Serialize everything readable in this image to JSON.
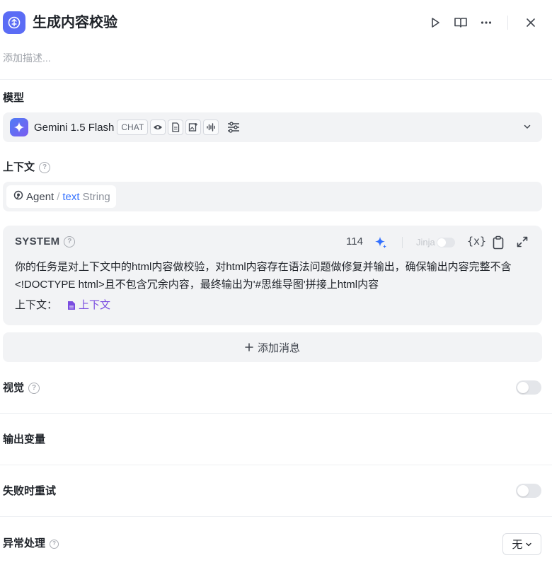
{
  "header": {
    "title": "生成内容校验"
  },
  "description": {
    "placeholder": "添加描述..."
  },
  "model": {
    "label": "模型",
    "name": "Gemini 1.5 Flash",
    "tag": "CHAT",
    "capability_icons": [
      "eye-icon",
      "document-icon",
      "image-icon",
      "audio-icon"
    ]
  },
  "context": {
    "label": "上下文",
    "source": "Agent",
    "separator": "/",
    "variable": "text",
    "type": "String"
  },
  "system": {
    "label": "SYSTEM",
    "token_count": "114",
    "jinja_label": "Jinja",
    "fx_label": "{x}",
    "prompt_text": "你的任务是对上下文中的html内容做校验，对html内容存在语法问题做修复并输出，确保输出内容完整不含<!DOCTYPE html>且不包含冗余内容，最终输出为'#思维导图'拼接上html内容",
    "context_prefix": "上下文：",
    "context_ref": "上下文"
  },
  "add_message": {
    "label": "添加消息"
  },
  "vision": {
    "label": "视觉",
    "enabled": false
  },
  "output_vars": {
    "label": "输出变量"
  },
  "retry": {
    "label": "失败时重试",
    "enabled": false
  },
  "error_handling": {
    "label": "异常处理",
    "value": "无"
  },
  "colors": {
    "accent": "#5b6cf5",
    "link": "#3370ff",
    "context_ref": "#7a4ce0",
    "panel_bg": "#f2f3f5"
  }
}
